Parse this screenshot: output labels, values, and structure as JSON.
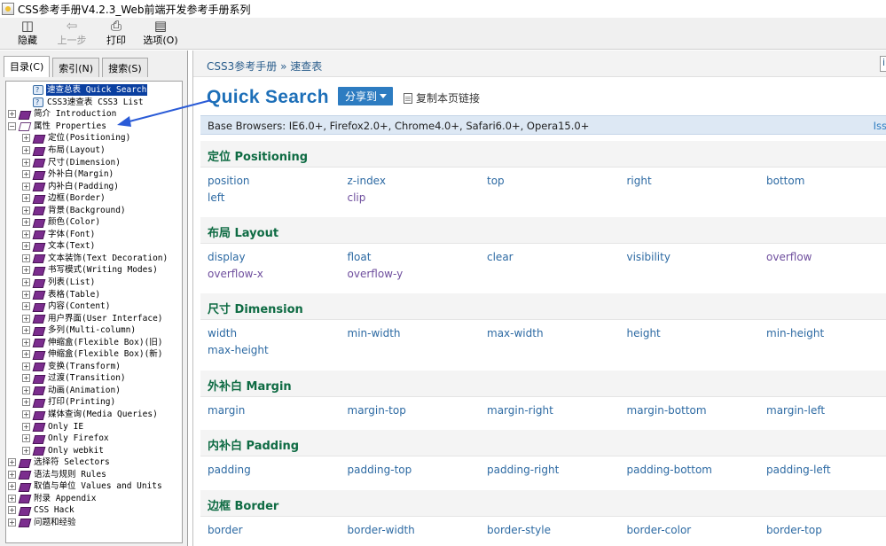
{
  "window": {
    "title": "CSS参考手册V4.2.3_Web前端开发参考手册系列"
  },
  "toolbar": {
    "buttons": [
      {
        "label": "隐藏",
        "icon": "hide-icon",
        "enabled": true
      },
      {
        "label": "上一步",
        "icon": "back-arrow-icon",
        "enabled": false
      },
      {
        "label": "打印",
        "icon": "print-icon",
        "enabled": true
      },
      {
        "label": "选项(O)",
        "icon": "options-icon",
        "enabled": true
      }
    ]
  },
  "sidebar": {
    "tabs": [
      "目录(C)",
      "索引(N)",
      "搜索(S)"
    ],
    "tree": [
      {
        "label": "速查总表 Quick Search",
        "level": 1,
        "icon": "page",
        "expander": "",
        "selected": true
      },
      {
        "label": "CSS3速查表 CSS3 List",
        "level": 1,
        "icon": "page",
        "expander": ""
      },
      {
        "label": "简介 Introduction",
        "level": 0,
        "icon": "book",
        "expander": "+"
      },
      {
        "label": "属性 Properties",
        "level": 0,
        "icon": "book-open",
        "expander": "−"
      },
      {
        "label": "定位(Positioning)",
        "level": 1,
        "icon": "book",
        "expander": "+"
      },
      {
        "label": "布局(Layout)",
        "level": 1,
        "icon": "book",
        "expander": "+"
      },
      {
        "label": "尺寸(Dimension)",
        "level": 1,
        "icon": "book",
        "expander": "+"
      },
      {
        "label": "外补白(Margin)",
        "level": 1,
        "icon": "book",
        "expander": "+"
      },
      {
        "label": "内补白(Padding)",
        "level": 1,
        "icon": "book",
        "expander": "+"
      },
      {
        "label": "边框(Border)",
        "level": 1,
        "icon": "book",
        "expander": "+"
      },
      {
        "label": "背景(Background)",
        "level": 1,
        "icon": "book",
        "expander": "+"
      },
      {
        "label": "颜色(Color)",
        "level": 1,
        "icon": "book",
        "expander": "+"
      },
      {
        "label": "字体(Font)",
        "level": 1,
        "icon": "book",
        "expander": "+"
      },
      {
        "label": "文本(Text)",
        "level": 1,
        "icon": "book",
        "expander": "+"
      },
      {
        "label": "文本装饰(Text Decoration)",
        "level": 1,
        "icon": "book",
        "expander": "+"
      },
      {
        "label": "书写模式(Writing Modes)",
        "level": 1,
        "icon": "book",
        "expander": "+"
      },
      {
        "label": "列表(List)",
        "level": 1,
        "icon": "book",
        "expander": "+"
      },
      {
        "label": "表格(Table)",
        "level": 1,
        "icon": "book",
        "expander": "+"
      },
      {
        "label": "内容(Content)",
        "level": 1,
        "icon": "book",
        "expander": "+"
      },
      {
        "label": "用户界面(User Interface)",
        "level": 1,
        "icon": "book",
        "expander": "+"
      },
      {
        "label": "多列(Multi-column)",
        "level": 1,
        "icon": "book",
        "expander": "+"
      },
      {
        "label": "伸缩盒(Flexible Box)(旧)",
        "level": 1,
        "icon": "book",
        "expander": "+"
      },
      {
        "label": "伸缩盒(Flexible Box)(新)",
        "level": 1,
        "icon": "book",
        "expander": "+"
      },
      {
        "label": "变换(Transform)",
        "level": 1,
        "icon": "book",
        "expander": "+"
      },
      {
        "label": "过渡(Transition)",
        "level": 1,
        "icon": "book",
        "expander": "+"
      },
      {
        "label": "动画(Animation)",
        "level": 1,
        "icon": "book",
        "expander": "+"
      },
      {
        "label": "打印(Printing)",
        "level": 1,
        "icon": "book",
        "expander": "+"
      },
      {
        "label": "媒体查询(Media Queries)",
        "level": 1,
        "icon": "book",
        "expander": "+"
      },
      {
        "label": "Only IE",
        "level": 1,
        "icon": "book",
        "expander": "+"
      },
      {
        "label": "Only Firefox",
        "level": 1,
        "icon": "book",
        "expander": "+"
      },
      {
        "label": "Only webkit",
        "level": 1,
        "icon": "book",
        "expander": "+"
      },
      {
        "label": "选择符 Selectors",
        "level": 0,
        "icon": "book",
        "expander": "+"
      },
      {
        "label": "语法与规则 Rules",
        "level": 0,
        "icon": "book",
        "expander": "+"
      },
      {
        "label": "取值与单位 Values and Units",
        "level": 0,
        "icon": "book",
        "expander": "+"
      },
      {
        "label": "附录 Appendix",
        "level": 0,
        "icon": "book",
        "expander": "+"
      },
      {
        "label": "CSS Hack",
        "level": 0,
        "icon": "book",
        "expander": "+"
      },
      {
        "label": "问题和经验",
        "level": 0,
        "icon": "book",
        "expander": "+"
      }
    ]
  },
  "content": {
    "breadcrumb": "CSS3参考手册 » 速查表",
    "title": "Quick Search",
    "share_label": "分享到",
    "copy_link_label": "复制本页链接",
    "browsers_text": "Base Browsers: IE6.0+, Firefox2.0+, Chrome4.0+, Safari6.0+, Opera15.0+",
    "browsers_right": "Iss",
    "sections": [
      {
        "heading": "定位 Positioning",
        "items": [
          "position",
          "z-index",
          "top",
          "right",
          "bottom",
          "left",
          "clip"
        ]
      },
      {
        "heading": "布局 Layout",
        "items": [
          "display",
          "float",
          "clear",
          "visibility",
          "overflow",
          "overflow-x",
          "overflow-y"
        ]
      },
      {
        "heading": "尺寸 Dimension",
        "items": [
          "width",
          "min-width",
          "max-width",
          "height",
          "min-height",
          "max-height"
        ]
      },
      {
        "heading": "外补白 Margin",
        "items": [
          "margin",
          "margin-top",
          "margin-right",
          "margin-bottom",
          "margin-left"
        ]
      },
      {
        "heading": "内补白 Padding",
        "items": [
          "padding",
          "padding-top",
          "padding-right",
          "padding-bottom",
          "padding-left"
        ]
      },
      {
        "heading": "边框 Border",
        "items": [
          "border",
          "border-width",
          "border-style",
          "border-color",
          "border-top"
        ]
      }
    ]
  },
  "colors": {
    "title_blue": "#1d6fb8",
    "section_green": "#0e6b43",
    "link_blue": "#2d6aa3",
    "link_visited": "#6f4f9e",
    "share_button": "#2d7cc1",
    "browsers_bar": "#dde8f4",
    "tree_selection": "#0a3fa0",
    "annotation_arrow": "#2a5bd7"
  }
}
